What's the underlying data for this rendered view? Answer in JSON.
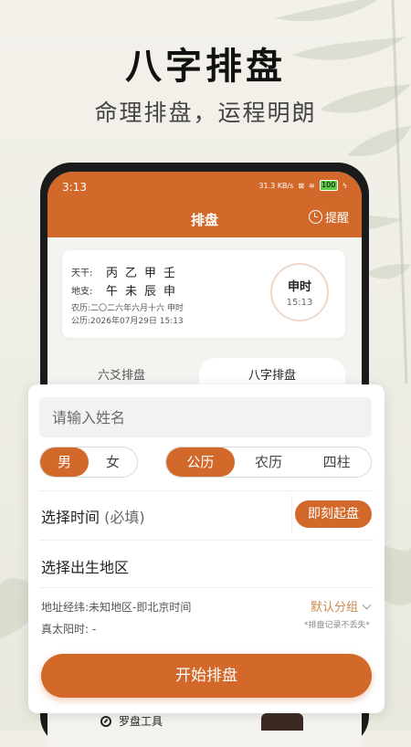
{
  "hero": {
    "title": "八字排盘",
    "subtitle": "命理排盘，运程明朗"
  },
  "status": {
    "time": "3:13",
    "speed": "31.3 KB/s",
    "battery": "100"
  },
  "appbar": {
    "title": "排盘",
    "remind": "提醒"
  },
  "bazi": {
    "tiangan_label": "天干:",
    "tiangan": "丙乙甲壬",
    "dizhi_label": "地支:",
    "dizhi": "午未辰申",
    "lunar_label": "农历:",
    "lunar": "二〇二六年六月十六 申时",
    "solar_label": "公历:",
    "solar": "2026年07月29日 15:13",
    "shichen": "申时",
    "shichen_time": "15:13"
  },
  "tabs": {
    "tab1": "六爻排盘",
    "tab2": "八字排盘"
  },
  "form": {
    "name_placeholder": "请输入姓名",
    "gender": [
      "男",
      "女"
    ],
    "calendar": [
      "公历",
      "农历",
      "四柱"
    ],
    "time_label": "选择时间",
    "time_required": "(必填)",
    "now_button": "即刻起盘",
    "region_label": "选择出生地区",
    "address": "地址经纬:未知地区-即北京时间",
    "true_sun": "真太阳时: -",
    "group": "默认分组",
    "note": "*排盘记录不丢失*",
    "start": "开始排盘"
  },
  "bottom": {
    "tool": "罗盘工具"
  },
  "colors": {
    "accent": "#d2692a"
  }
}
